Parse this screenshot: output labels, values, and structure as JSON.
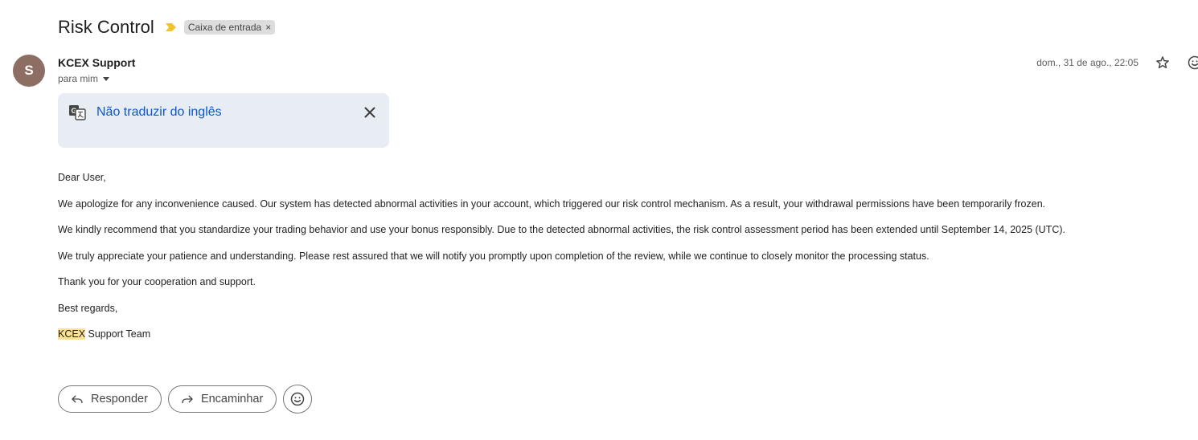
{
  "email": {
    "subject": "Risk Control",
    "label": "Caixa de entrada",
    "label_remove": "×",
    "sender_initial": "S",
    "sender_name": "KCEX Support",
    "recipient": "para mim",
    "date": "dom., 31 de ago., 22:05"
  },
  "translate": {
    "link_text": "Não traduzir do inglês"
  },
  "body": {
    "greeting": "Dear User,",
    "p1": "We apologize for any inconvenience caused. Our system has detected abnormal activities in your account, which triggered our risk control mechanism. As a result, your withdrawal permissions have been temporarily frozen.",
    "p2": "We kindly recommend that you standardize your trading behavior and use your bonus responsibly. Due to the detected abnormal activities, the risk control assessment period has been extended until September 14, 2025 (UTC).",
    "p3": "We truly appreciate your patience and understanding. Please rest assured that we will notify you promptly upon completion of the review, while we continue to closely monitor the processing status.",
    "p4": "Thank you for your cooperation and support.",
    "closing": "Best regards,",
    "signature_highlight": "KCEX",
    "signature_rest": " Support Team"
  },
  "actions": {
    "reply": "Responder",
    "forward": "Encaminhar"
  },
  "icons": {
    "importance": "importance-marker-icon",
    "star": "star-icon",
    "emoji": "emoji-icon",
    "translate": "translate-icon",
    "close": "close-icon",
    "reply": "reply-icon",
    "forward": "forward-icon"
  },
  "colors": {
    "avatar": "#8d6e63",
    "importance": "#f2c230",
    "link": "#0b57d0",
    "highlight": "#fde293",
    "translate_bg": "#e8ecf3"
  }
}
